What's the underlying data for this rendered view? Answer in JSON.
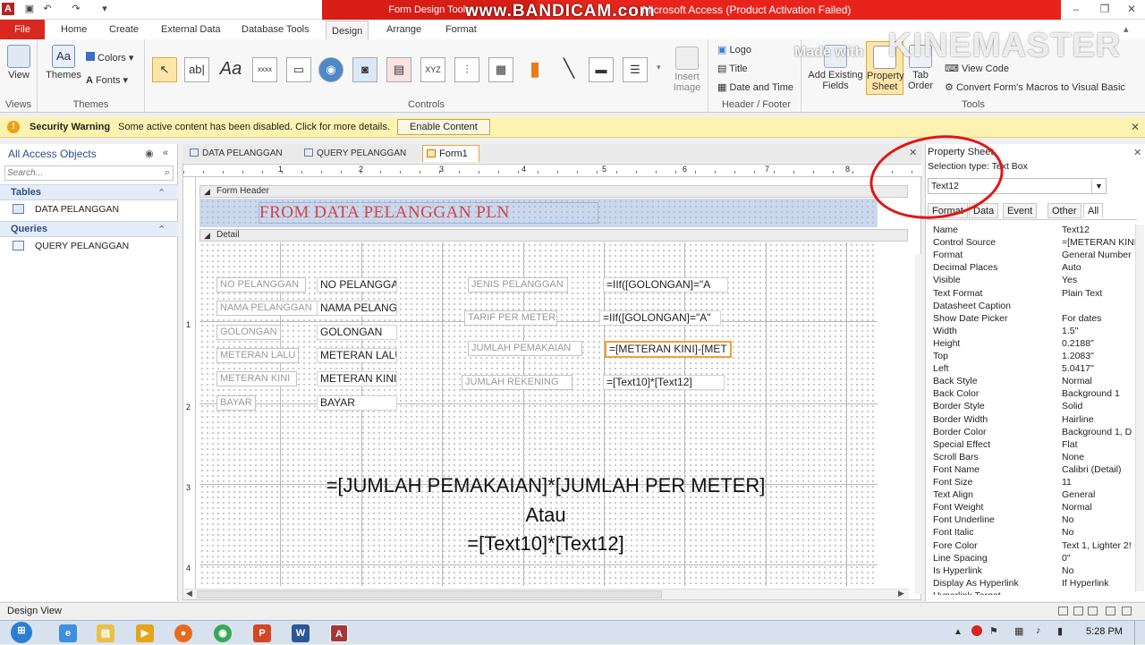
{
  "app": {
    "app_icon": "A",
    "context_title": "Form Design Tools",
    "window_title": "Microsoft Access (Product Activation Failed)",
    "watermark_bandicam": "www.BANDICAM.com",
    "watermark_kinemaster": "KINEMASTER",
    "watermark_madewith": "Made with"
  },
  "ribbon_tabs": [
    "File",
    "Home",
    "Create",
    "External Data",
    "Database Tools",
    "Design",
    "Arrange",
    "Format"
  ],
  "ribbon": {
    "views_label": "View",
    "views_group": "Views",
    "themes_label": "Themes",
    "colors_label": "Colors",
    "fonts_label": "Fonts",
    "themes_group": "Themes",
    "controls_group": "Controls",
    "insert_image": "Insert Image",
    "logo": "Logo",
    "title": "Title",
    "date_time": "Date and Time",
    "header_footer_group": "Header / Footer",
    "add_fields": "Add Existing Fields",
    "property_sheet": "Property Sheet",
    "tab_order": "Tab Order",
    "view_code": "View Code",
    "convert_macros": "Convert Form's Macros to Visual Basic",
    "tools_group": "Tools"
  },
  "security": {
    "title": "Security Warning",
    "message": "Some active content has been disabled. Click for more details.",
    "button": "Enable Content"
  },
  "nav": {
    "header": "All Access Objects",
    "search_placeholder": "Search...",
    "group_tables": "Tables",
    "table_1": "DATA PELANGGAN",
    "group_queries": "Queries",
    "query_1": "QUERY PELANGGAN"
  },
  "doc_tabs": [
    "DATA PELANGGAN",
    "QUERY PELANGGAN",
    "Form1"
  ],
  "form": {
    "header_section": "Form Header",
    "detail_section": "Detail",
    "title": "FROM DATA PELANGGAN PLN",
    "labels_left": [
      "NO PELANGGAN",
      "NAMA PELANGGAN",
      "GOLONGAN",
      "METERAN LALU",
      "METERAN KINI",
      "BAYAR"
    ],
    "boxes_left": [
      "NO PELANGGAI",
      "NAMA PELANG",
      "GOLONGAN",
      "METERAN LALU",
      "METERAN KINI",
      "BAYAR"
    ],
    "labels_right": [
      "JENIS PELANGGAN",
      "TARIF PER METER",
      "JUMLAH PEMAKAIAN",
      "JUMLAH REKENING"
    ],
    "boxes_right": [
      "=IIf([GOLONGAN]=\"A",
      "=IIf([GOLONGAN]=\"A\"",
      "=[METERAN KINI]-[MET",
      "=[Text10]*[Text12]"
    ],
    "ruler_top": [
      "1",
      "2",
      "3",
      "4",
      "5",
      "6",
      "7",
      "8"
    ],
    "ruler_left": [
      "1",
      "2",
      "3",
      "4"
    ]
  },
  "annotation": {
    "line1": "=[JUMLAH PEMAKAIAN]*[JUMLAH PER METER]",
    "line2": "Atau",
    "line3": "=[Text10]*[Text12]"
  },
  "property_sheet": {
    "title": "Property Sheet",
    "selection_type": "Selection type: Text Box",
    "selected_control": "Text12",
    "tabs": [
      "Format",
      "Data",
      "Event",
      "Other",
      "All"
    ],
    "rows": [
      [
        "Name",
        "Text12"
      ],
      [
        "Control Source",
        "=[METERAN KINI"
      ],
      [
        "Format",
        "General Number"
      ],
      [
        "Decimal Places",
        "Auto"
      ],
      [
        "Visible",
        "Yes"
      ],
      [
        "Text Format",
        "Plain Text"
      ],
      [
        "Datasheet Caption",
        ""
      ],
      [
        "Show Date Picker",
        "For dates"
      ],
      [
        "Width",
        "1.5\""
      ],
      [
        "Height",
        "0.2188\""
      ],
      [
        "Top",
        "1.2083\""
      ],
      [
        "Left",
        "5.0417\""
      ],
      [
        "Back Style",
        "Normal"
      ],
      [
        "Back Color",
        "Background 1"
      ],
      [
        "Border Style",
        "Solid"
      ],
      [
        "Border Width",
        "Hairline"
      ],
      [
        "Border Color",
        "Background 1, D"
      ],
      [
        "Special Effect",
        "Flat"
      ],
      [
        "Scroll Bars",
        "None"
      ],
      [
        "Font Name",
        "Calibri (Detail)"
      ],
      [
        "Font Size",
        "11"
      ],
      [
        "Text Align",
        "General"
      ],
      [
        "Font Weight",
        "Normal"
      ],
      [
        "Font Underline",
        "No"
      ],
      [
        "Font Italic",
        "No"
      ],
      [
        "Fore Color",
        "Text 1, Lighter 2!"
      ],
      [
        "Line Spacing",
        "0\""
      ],
      [
        "Is Hyperlink",
        "No"
      ],
      [
        "Display As Hyperlink",
        "If Hyperlink"
      ],
      [
        "Hyperlink Target",
        ""
      ]
    ]
  },
  "status": {
    "left": "Design View",
    "clock": "5:28 PM"
  },
  "colors": {
    "file_tab": "#d9281f",
    "title_red": "#e8231b",
    "security_bar": "#fdf3b0",
    "selection_orange": "#f0a13a",
    "annotation_circle": "#e21616"
  }
}
